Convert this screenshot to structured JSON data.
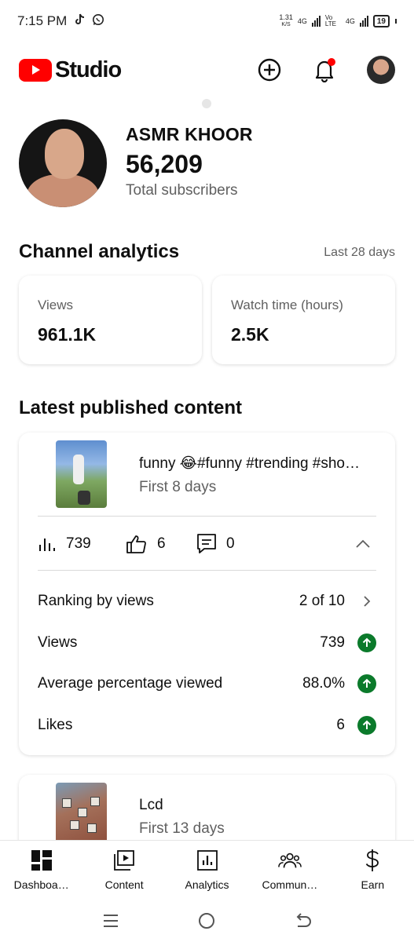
{
  "status_bar": {
    "time": "7:15 PM",
    "speed": "1.31",
    "speed_unit": "K/S",
    "net1": "4G",
    "volte": "Vo LTE",
    "net2": "4G",
    "battery": "19",
    "icons": [
      "tiktok-icon",
      "whatsapp-icon",
      "signal-icon",
      "battery-icon"
    ]
  },
  "header": {
    "brand": "Studio",
    "icons": [
      "create-icon",
      "notifications-icon",
      "account-avatar"
    ],
    "brand_color": "#ff0000",
    "notification_dot_color": "#ff0000"
  },
  "channel": {
    "name": "ASMR KHOOR",
    "subscribers": "56,209",
    "subscribers_label": "Total subscribers"
  },
  "analytics": {
    "title": "Channel analytics",
    "period": "Last 28 days",
    "cards": [
      {
        "label": "Views",
        "value": "961.1K"
      },
      {
        "label": "Watch time (hours)",
        "value": "2.5K"
      }
    ]
  },
  "latest": {
    "title": "Latest published content",
    "video": {
      "title": "funny 😂#funny #trending #sho…",
      "age": "First 8 days",
      "views": "739",
      "likes": "6",
      "comments": "0",
      "performance": [
        {
          "label": "Ranking by views",
          "value": "2 of 10",
          "icon": "chevron-right-icon"
        },
        {
          "label": "Views",
          "value": "739",
          "icon": "trend-up-icon"
        },
        {
          "label": "Average percentage viewed",
          "value": "88.0%",
          "icon": "trend-up-icon"
        },
        {
          "label": "Likes",
          "value": "6",
          "icon": "trend-up-icon"
        }
      ]
    },
    "video2": {
      "title": "Lcd",
      "age": "First 13 days"
    }
  },
  "bottom_nav": [
    {
      "label": "Dashboa…",
      "icon": "dashboard-icon"
    },
    {
      "label": "Content",
      "icon": "content-icon"
    },
    {
      "label": "Analytics",
      "icon": "analytics-icon"
    },
    {
      "label": "Commun…",
      "icon": "community-icon"
    },
    {
      "label": "Earn",
      "icon": "earn-icon"
    }
  ],
  "colors": {
    "trend_up": "#0b7a2b",
    "secondary_text": "#606060"
  }
}
